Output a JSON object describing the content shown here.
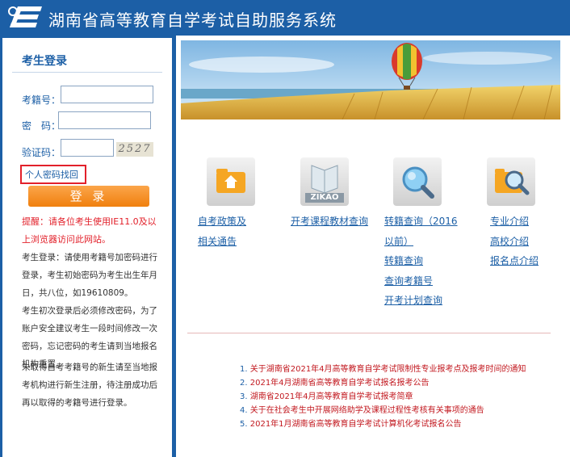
{
  "header": {
    "title": "湖南省高等教育自学考试自助服务系统"
  },
  "login": {
    "title": "考生登录",
    "exam_number_label": "考籍号：",
    "password_label": "密　码：",
    "captcha_label": "验证码：",
    "captcha_text": "2527",
    "retrieve_link": "个人密码找回",
    "login_button": "登 录",
    "notice": "提醒：请各位考生使用IE11.0及以上浏览器访问此网站。",
    "info": [
      "考生登录：请使用考籍号加密码进行登录，考生初始密码为考生出生年月日，共八位，如19610809。",
      "考生初次登录后必须修改密码，为了账户安全建议考生一段时间修改一次密码，忘记密码的考生请到当地报名机构重置。",
      "未取得自考考籍号的新生请至当地报考机构进行新生注册，待注册成功后再以取得的考籍号进行登录。"
    ]
  },
  "tiles": [
    {
      "icon": "folder-house-icon",
      "links": [
        "自考政策及相关通告"
      ]
    },
    {
      "icon": "zikao-book-icon",
      "icon_text": "ZIKAO",
      "links": [
        "开考课程教材查询"
      ]
    },
    {
      "icon": "magnifier-icon",
      "links": [
        "转籍查询（2016以前）",
        "转籍查询",
        "查询考籍号",
        "开考计划查询"
      ]
    },
    {
      "icon": "folder-magnifier-icon",
      "links": [
        "专业介绍",
        "高校介绍",
        "报名点介绍"
      ]
    }
  ],
  "news": [
    {
      "num": "1.",
      "text": "关于湖南省2021年4月高等教育自学考试限制性专业报考点及报考时间的通知"
    },
    {
      "num": "2.",
      "text": "2021年4月湖南省高等教育自学考试报名报考公告"
    },
    {
      "num": "3.",
      "text": "湖南省2021年4月高等教育自学考试报考简章"
    },
    {
      "num": "4.",
      "text": "关于在社会考生中开展网络助学及课程过程性考核有关事项的通告"
    },
    {
      "num": "5.",
      "text": "2021年1月湖南省高等教育自学考试计算机化考试报名公告"
    }
  ],
  "colors": {
    "header_blue": "#1c5fa6",
    "login_orange": "#f0800e",
    "alert_red": "#e2202a"
  }
}
